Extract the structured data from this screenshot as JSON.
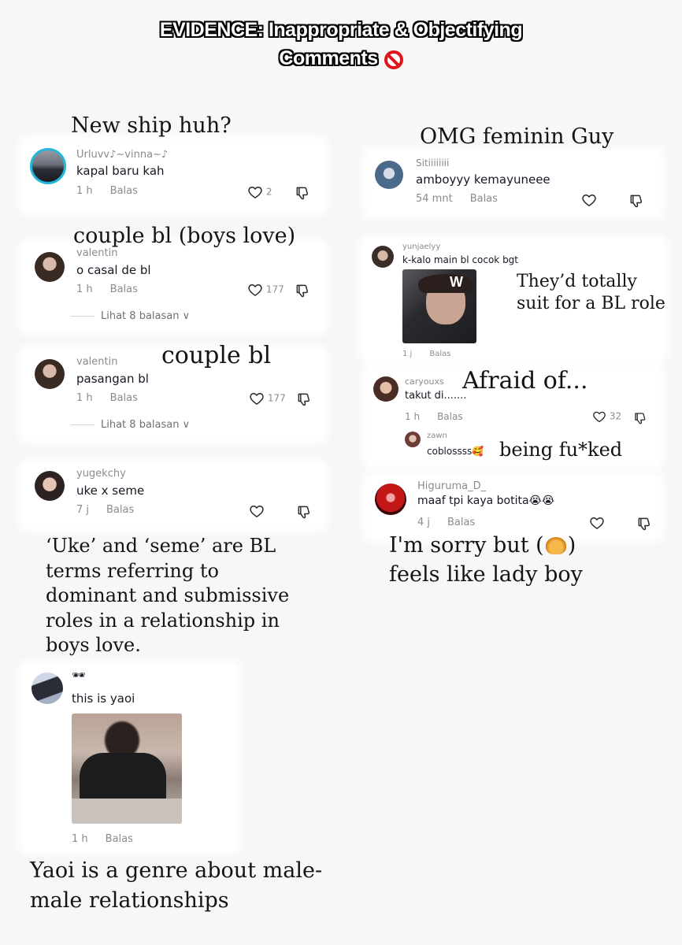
{
  "header": {
    "line1": "EVIDENCE: Inappropriate & Objectifying",
    "line2": "Comments"
  },
  "notes": {
    "n1": "New ship huh?",
    "n2": "couple bl  (boys love)",
    "n3": "couple bl",
    "n4a": "‘Uke’ and ‘seme’ are BL",
    "n4b": "terms referring to",
    "n4c": "dominant and submissive",
    "n4d": "roles in a relationship in",
    "n4e": "boys love.",
    "n5a": "Yaoi is a genre about male-",
    "n5b": "male relationships",
    "n6": "OMG feminin Guy",
    "n7a": "They’d totally",
    "n7b": "suit for a BL role",
    "n8": "Afraid of...",
    "n9": "being fu*ked",
    "n10a": "I'm sorry but (",
    "n10b": ")",
    "n10c": "feels like lady boy"
  },
  "comments": {
    "c1": {
      "user": "Urluvv♪~vinna~♪",
      "text": "kapal baru kah",
      "time": "1 h",
      "reply": "Balas",
      "likes": "2"
    },
    "c2": {
      "user": "valentin",
      "text": "o casal de bl",
      "time": "1 h",
      "reply": "Balas",
      "likes": "177",
      "more": "Lihat 8 balasan ∨"
    },
    "c3": {
      "user": "valentin",
      "text": "pasangan bl",
      "time": "1 h",
      "reply": "Balas",
      "likes": "177",
      "more": "Lihat 8 balasan ∨"
    },
    "c4": {
      "user": "yugekchy",
      "text": "uke x seme",
      "time": "7 j",
      "reply": "Balas"
    },
    "c5": {
      "user": "🕶",
      "text": "this is yaoi",
      "time": "1 h",
      "reply": "Balas"
    },
    "c6": {
      "user": "Sitiiiiiiii",
      "text": "amboyyy kemayuneee",
      "time": "54 mnt",
      "reply": "Balas"
    },
    "c7": {
      "user": "yunjaelyy",
      "text": "k-kalo main bl cocok bgt",
      "time": "1 j",
      "reply": "Balas"
    },
    "c8": {
      "user": "caryouxs",
      "text": "takut di.......",
      "time": "1 h",
      "reply": "Balas",
      "likes": "32"
    },
    "c9": {
      "user": "zawn",
      "text": "coblossss🥰"
    },
    "c10": {
      "user": "Higuruma_D_",
      "text": "maaf tpi kaya botita😭😭",
      "time": "4 j",
      "reply": "Balas"
    }
  },
  "icons": {
    "heart": "heart-outline-icon",
    "dislike": "thumbs-down-icon",
    "ban": "prohibited-icon",
    "croissant": "croissant-emoji"
  },
  "colors": {
    "avatar_ring": "#22b6d9",
    "ban": "#e0141c"
  }
}
